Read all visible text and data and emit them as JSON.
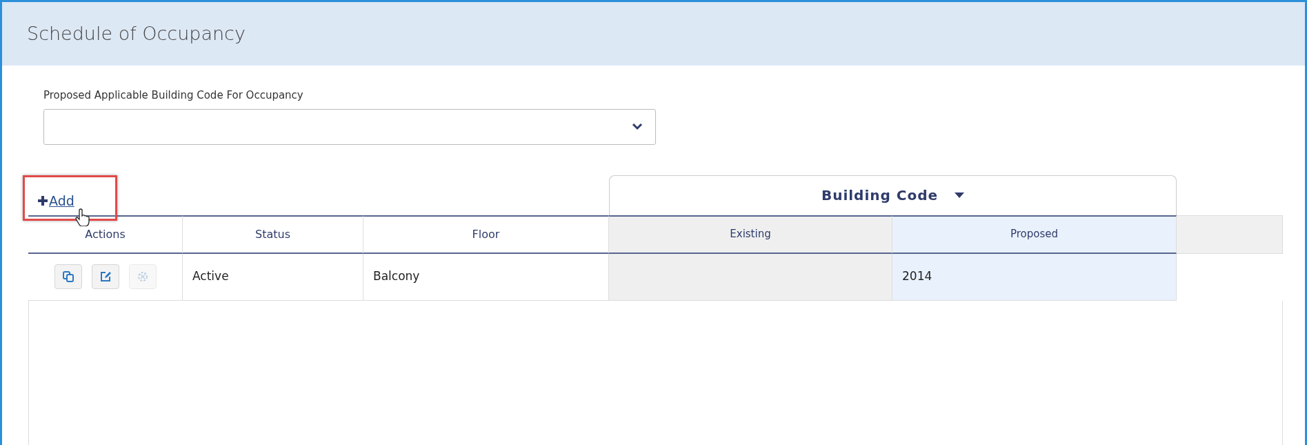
{
  "panel": {
    "title": "Schedule of Occupancy"
  },
  "code_field": {
    "label": "Proposed Applicable Building Code For Occupancy"
  },
  "add_link": {
    "label": "Add",
    "highlighted": true
  },
  "column_group": {
    "label": "Building Code"
  },
  "table": {
    "columns": [
      {
        "label": "Actions",
        "kind": "plain",
        "highlighted": false
      },
      {
        "label": "Status",
        "kind": "plain",
        "highlighted": false
      },
      {
        "label": "Floor",
        "kind": "plain",
        "highlighted": false
      },
      {
        "label": "Existing",
        "kind": "group",
        "highlighted": false
      },
      {
        "label": "Proposed",
        "kind": "group",
        "highlighted": true
      }
    ],
    "rows": [
      {
        "actions": [
          {
            "kind": "copy",
            "disabled": false
          },
          {
            "kind": "edit",
            "disabled": false
          },
          {
            "kind": "delete",
            "disabled": true
          }
        ],
        "status": "Active",
        "floor": "Balcony",
        "existing": "",
        "proposed": "2014"
      }
    ]
  }
}
